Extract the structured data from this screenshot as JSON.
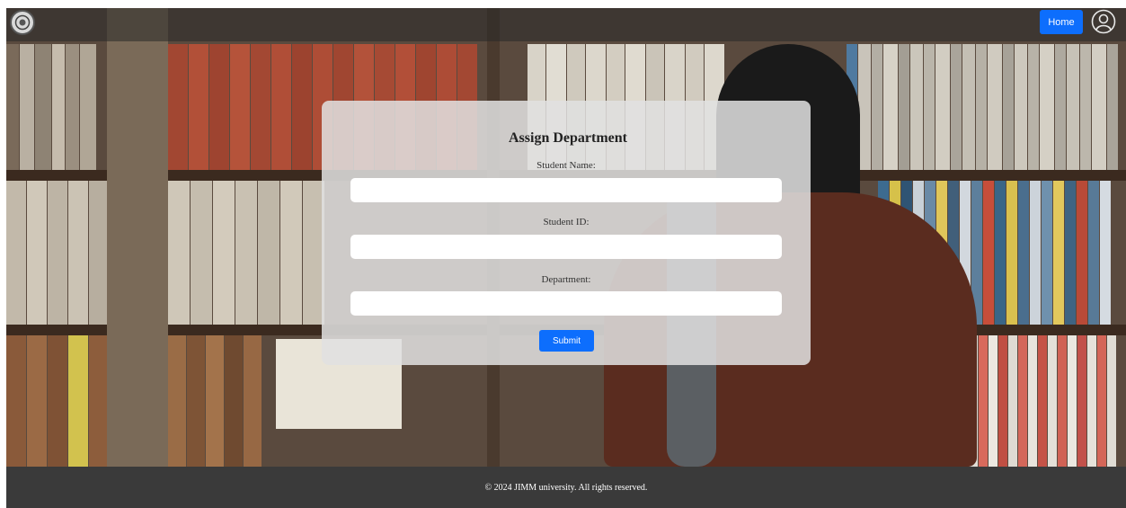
{
  "header": {
    "home_label": "Home",
    "logo_icon": "university-seal-icon",
    "user_icon": "user-circle-icon",
    "accent_color": "#0d6efd"
  },
  "form": {
    "title": "Assign Department",
    "fields": [
      {
        "label": "Student Name:",
        "value": "",
        "placeholder": ""
      },
      {
        "label": "Student ID:",
        "value": "",
        "placeholder": ""
      },
      {
        "label": "Department:",
        "value": "",
        "placeholder": ""
      }
    ],
    "submit_label": "Submit"
  },
  "footer": {
    "text": "© 2024 JIMM university. All rights reserved."
  }
}
